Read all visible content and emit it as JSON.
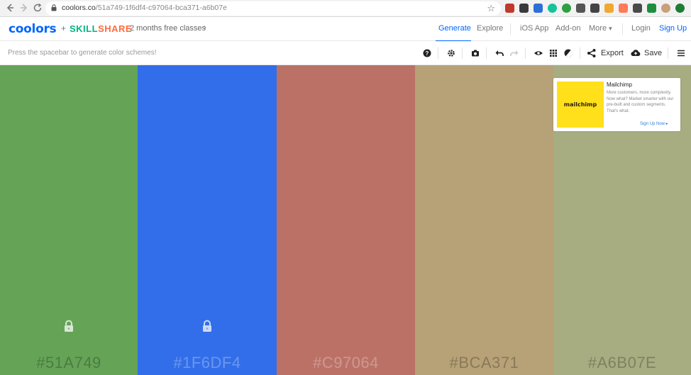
{
  "browser": {
    "url_host": "coolors.co",
    "url_path": "/51a749-1f6df4-c97064-bca371-a6b07e",
    "back_icon": "back-arrow-icon",
    "forward_icon": "forward-arrow-icon",
    "reload_icon": "reload-icon",
    "extensions": [
      {
        "name": "ext-red-icon",
        "color": "#c0392b"
      },
      {
        "name": "ext-shield-icon",
        "color": "#3a3a3a"
      },
      {
        "name": "ext-pen-icon",
        "color": "#2c6fd6"
      },
      {
        "name": "ext-grammarly-icon",
        "color": "#15c39a"
      },
      {
        "name": "ext-green-icon",
        "color": "#2ea043"
      },
      {
        "name": "ext-pin-icon",
        "color": "#555555"
      },
      {
        "name": "ext-screen-icon",
        "color": "#444444"
      },
      {
        "name": "ext-folder-icon",
        "color": "#f0a830"
      },
      {
        "name": "ext-hubspot-icon",
        "color": "#ff7a59"
      },
      {
        "name": "ext-wordpress-icon",
        "color": "#4a4a4a"
      },
      {
        "name": "ext-sheet-icon",
        "color": "#1e8e3e"
      },
      {
        "name": "ext-avatar-icon",
        "color": "#c9a07a"
      },
      {
        "name": "ext-green-dot-icon",
        "color": "#1e7d32"
      }
    ]
  },
  "header": {
    "logo": "coolors",
    "plus": "+",
    "partner_a": "SKILL",
    "partner_b": "SHARE",
    "promo": "2 months free classes",
    "nav": {
      "generate": "Generate",
      "explore": "Explore",
      "ios_app": "iOS App",
      "addon": "Add-on",
      "more": "More",
      "login": "Login",
      "signup": "Sign Up"
    }
  },
  "toolbar": {
    "hint": "Press the spacebar to generate color schemes!",
    "export": "Export",
    "save": "Save"
  },
  "palette": [
    {
      "hex": "#51A749",
      "color": "#65a457",
      "locked": true,
      "dark": false
    },
    {
      "hex": "#1F6DF4",
      "color": "#326ee9",
      "locked": true,
      "dark": true
    },
    {
      "hex": "#C97064",
      "color": "#bb7166",
      "locked": false,
      "dark": true
    },
    {
      "hex": "#BCA371",
      "color": "#b7a177",
      "locked": false,
      "dark": false
    },
    {
      "hex": "#A6B07E",
      "color": "#a7ad81",
      "locked": false,
      "dark": false
    }
  ],
  "ad": {
    "logo_text": "mailchimp",
    "title": "Mailchimp",
    "body": "More customers, more complexity. Now what? Market smarter with our pre-built and custom segments. That's what.",
    "cta": "Sign Up Now ▸"
  }
}
